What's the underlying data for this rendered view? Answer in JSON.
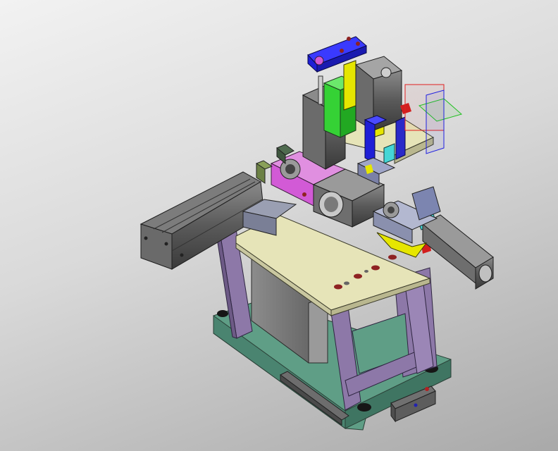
{
  "scene": {
    "kind": "cad-3d-assembly-render",
    "description_visible_text": [],
    "colors": {
      "background_top": "#f2f2f2",
      "background_bottom": "#a9a9a9",
      "base_plate": "#5f9e86",
      "frame_legs": "#8d78a8",
      "top_plate": "#e6e4b8",
      "cylinder_body": "#5e5e5e",
      "sheet_metal_box": "#7a7a7a",
      "block_blue": "#1f1fd6",
      "block_green": "#35d235",
      "block_magenta": "#d25ad6",
      "block_yellow": "#e6e600",
      "block_cyan": "#45d6d6",
      "accent_red": "#d21e1e",
      "triad_red": "#e02020",
      "triad_green": "#20c020",
      "triad_blue": "#2020e0"
    }
  }
}
